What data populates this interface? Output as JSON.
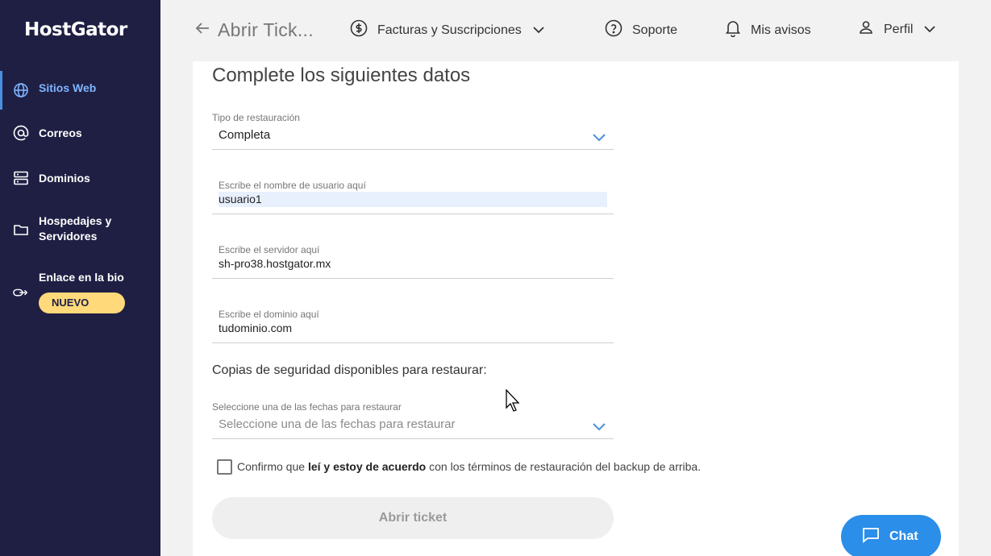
{
  "sidebar": {
    "logo": "HostGator",
    "items": [
      {
        "label": "Sitios Web",
        "icon": "globe-icon"
      },
      {
        "label": "Correos",
        "icon": "at-icon"
      },
      {
        "label": "Dominios",
        "icon": "server-icon"
      },
      {
        "label": "Hospedajes y",
        "label2": "Servidores",
        "icon": "folder-icon"
      },
      {
        "label": "Enlace en la bio",
        "icon": "link-icon",
        "badge": "NUEVO"
      }
    ]
  },
  "header": {
    "title": "Abrir Tick...",
    "billing": "Facturas y Suscripciones",
    "support": "Soporte",
    "notices": "Mis avisos",
    "profile": "Perfil"
  },
  "form": {
    "heading": "Complete los siguientes datos",
    "restore_type_label": "Tipo de restauración",
    "restore_type_value": "Completa",
    "username_label": "Escribe el nombre de usuario aquí",
    "username_value": "usuario1",
    "server_label": "Escribe el servidor aquí",
    "server_value": "sh-pro38.hostgator.mx",
    "domain_label": "Escribe el dominio aquí",
    "domain_value": "tudominio.com",
    "backups_heading": "Copias de seguridad disponibles para restaurar:",
    "date_label": "Seleccione una de las fechas para restaurar",
    "date_placeholder": "Seleccione una de las fechas para restaurar",
    "confirm_pre": "Confirmo que ",
    "confirm_bold": "leí y estoy de acuerdo",
    "confirm_post": " con los términos de restauración del backup de arriba.",
    "submit": "Abrir ticket"
  },
  "chat": {
    "label": "Chat"
  },
  "colors": {
    "sidebar": "#1f1f44",
    "accent": "#2b8ee8",
    "badge": "#ffd97a",
    "active": "#7fb6ff"
  }
}
